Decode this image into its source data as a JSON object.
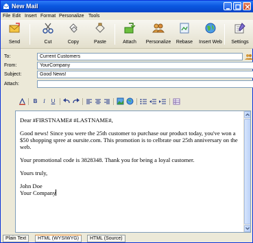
{
  "window": {
    "title": "New Mail"
  },
  "menu": [
    {
      "label": "File"
    },
    {
      "label": "Edit"
    },
    {
      "label": "Insert"
    },
    {
      "label": "Format"
    },
    {
      "label": "Personalize"
    },
    {
      "label": "Tools"
    }
  ],
  "toolbar": [
    {
      "label": "Send",
      "icon": "send-icon"
    },
    {
      "label": "Cut",
      "icon": "cut-icon"
    },
    {
      "label": "Copy",
      "icon": "copy-icon"
    },
    {
      "label": "Paste",
      "icon": "paste-icon"
    },
    {
      "label": "Attach",
      "icon": "attach-icon"
    },
    {
      "label": "Personalize",
      "icon": "personalize-icon"
    },
    {
      "label": "Rebase",
      "icon": "rebase-icon"
    },
    {
      "label": "Insert Web",
      "icon": "insert-web-icon"
    },
    {
      "label": "Settings",
      "icon": "settings-icon"
    }
  ],
  "fields": {
    "to": {
      "label": "To:",
      "value": "Current Customers"
    },
    "from": {
      "label": "From:",
      "value": "YourCompany"
    },
    "subject": {
      "label": "Subject:",
      "value": "Good News!"
    },
    "attach": {
      "label": "Attach:",
      "value": ""
    }
  },
  "format_toolbar": {
    "bold": "B",
    "italic": "I",
    "underline": "U"
  },
  "body": {
    "greeting": "Dear #FIRSTNAME# #LASTNAME#,",
    "para1": "Good news! Since you were the 25th customer to purchase our product today, you've won a $50 shopping spree at oursite.com. This promotion is to celbrate our 25th anniversary on the web.",
    "para2": "Your promotional code is 3828348. Thank you for being a loyal customer.",
    "closing": "Yours truly,",
    "sig_name": "John Doe",
    "sig_company": "Your Company"
  },
  "tabs": [
    {
      "label": "Plain Text",
      "active": false
    },
    {
      "label": "HTML (WYSIWYG)",
      "active": true
    },
    {
      "label": "HTML (Source)",
      "active": false
    }
  ],
  "colors": {
    "title_bar": "#0a57e0",
    "chrome": "#ece9d8",
    "accent": "#e68b2c"
  }
}
